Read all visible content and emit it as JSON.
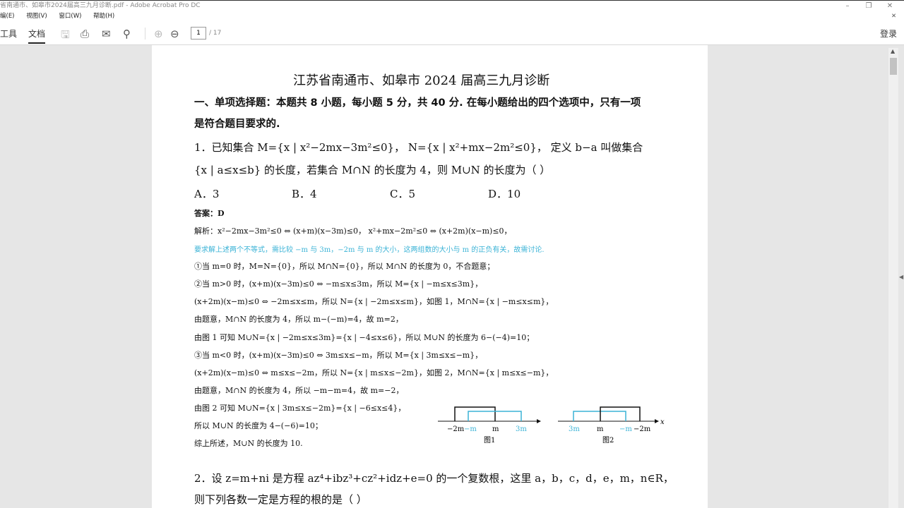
{
  "window": {
    "title": "省南通市、如皋市2024届高三九月诊断.pdf - Adobe Acrobat Pro DC"
  },
  "menu": [
    "编(E)",
    "视图(V)",
    "窗口(W)",
    "帮助(H)"
  ],
  "toolbar": {
    "tools": "工具",
    "document": "文档",
    "page_current": "1",
    "page_total": "/ 17",
    "login": "登录"
  },
  "doc": {
    "title": "江苏省南通市、如皋市 2024 届高三九月诊断",
    "section": "一、单项选择题：本题共 8 小题，每小题 5 分，共 40 分. 在每小题给出的四个选项中，只有一项",
    "section2": "是符合题目要求的.",
    "q1a": "1．已知集合 M={x | x²−2mx−3m²≤0}，  N={x | x²+mx−2m²≤0}，  定义 b−a 叫做集合",
    "q1b": "{x | a≤x≤b} 的长度，若集合 M∩N 的长度为 4，则 M∪N 的长度为（     ）",
    "options": [
      "A．3",
      "B．4",
      "C．5",
      "D．10"
    ],
    "answer": "答案：D",
    "lines": [
      "解析：x²−2mx−3m²≤0 ⇔ (x+m)(x−3m)≤0，  x²+mx−2m²≤0 ⇔ (x+2m)(x−m)≤0，",
      "要求解上述两个不等式，需比较 −m 与 3m，−2m 与 m 的大小，这两组数的大小与 m 的正负有关，故需讨论.",
      "①当 m=0 时，M=N={0}，所以 M∩N={0}，所以 M∩N 的长度为 0，不合题意；",
      "②当 m>0 时，(x+m)(x−3m)≤0 ⇔ −m≤x≤3m，所以 M={x | −m≤x≤3m}，",
      "(x+2m)(x−m)≤0 ⇔ −2m≤x≤m，所以 N={x | −2m≤x≤m}，如图 1，M∩N={x | −m≤x≤m}，",
      "由题意，M∩N 的长度为 4，所以 m−(−m)=4，故 m=2，",
      "由图 1 可知 M∪N={x | −2m≤x≤3m}={x | −4≤x≤6}，所以 M∪N 的长度为 6−(−4)=10；",
      "③当 m<0 时，(x+m)(x−3m)≤0 ⇔ 3m≤x≤−m，所以 M={x | 3m≤x≤−m}，",
      "(x+2m)(x−m)≤0 ⇔ m≤x≤−2m，所以 N={x | m≤x≤−2m}，如图 2，M∩N={x | m≤x≤−m}，",
      "由题意，M∩N 的长度为 4，所以 −m−m=4，故 m=−2，",
      "由图 2 可知 M∪N={x | 3m≤x≤−2m}={x | −6≤x≤4}，",
      "所以 M∪N 的长度为 4−(−6)=10；",
      "综上所述，M∪N 的长度为 10."
    ],
    "fig1": {
      "labels": [
        "−2m",
        "−m",
        "m",
        "3m"
      ],
      "caption": "图1"
    },
    "fig2": {
      "labels": [
        "3m",
        "m",
        "−m",
        "−2m",
        "x"
      ],
      "caption": "图2"
    },
    "q2a": "2．设 z=m+ni 是方程 az⁴+ibz³+cz²+idz+e=0 的一个复数根，这里 a，b，c，d，e，m，n∈R，",
    "q2b": "则下列各数一定是方程的根的是（     ）"
  },
  "colors": {
    "hint": "#3bb3d6"
  }
}
